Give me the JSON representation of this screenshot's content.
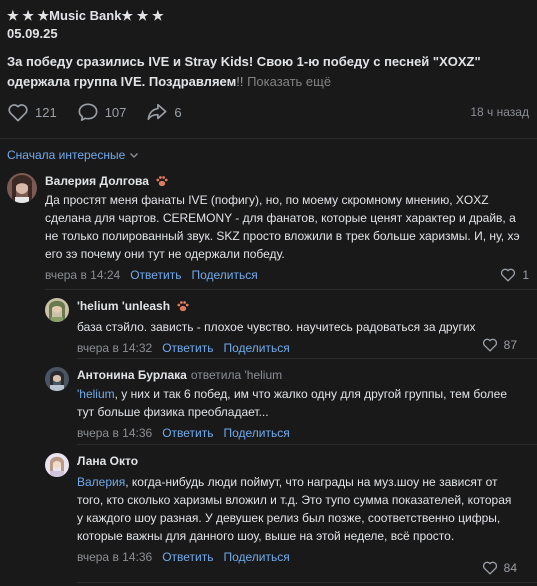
{
  "post": {
    "header": "★ ★ ★Music Bank★ ★ ★",
    "date": "05.09.25",
    "text_main": "За победу сразились IVE и Stray Kids! Свою 1-ю победу с песней \"XOXZ\" одержала группа IVE. Поздравляем",
    "text_fade": "!!",
    "show_more": "Показать ещё",
    "likes": "121",
    "comments": "107",
    "shares": "6",
    "time": "18 ч назад"
  },
  "sort_label": "Сначала интересные",
  "comments": [
    {
      "author": "Валерия Долгова",
      "text": "Да простят меня фанаты IVE (пофигу), но, по моему скромному мнению, XOXZ сделана для чартов. CEREMONY - для фанатов, которые ценят характер и драйв, а не только полированный звук. SKZ просто вложили в трек больше харизмы. И, ну, хэ его зэ почему они тут не одержали победу.",
      "time": "вчера в 14:24",
      "reply": "Ответить",
      "share": "Поделиться",
      "likes": "1"
    },
    {
      "author": "'helium 'unleash",
      "text": "база стэйло. зависть - плохое чувство. научитесь радоваться за других",
      "time": "вчера в 14:32",
      "reply": "Ответить",
      "share": "Поделиться",
      "likes": "87"
    },
    {
      "author": "Антонина Бурлака",
      "reply_to": "ответила 'helium",
      "addressee": "'helium",
      "text": ", у них и так 6 побед, им что жалко одну для другой группы, тем более тут больше физика преобладает...",
      "time": "вчера в 14:36",
      "reply": "Ответить",
      "share": "Поделиться"
    },
    {
      "author": "Лана Окто",
      "addressee": "Валерия",
      "text": ", когда-нибудь люди поймут, что награды на муз.шоу не зависят от того, кто сколько харизмы вложил и т.д. Это тупо сумма показателей, которая у каждого шоу разная. У девушек релиз был позже, соответственно цифры, которые важны для данного шоу, выше на этой неделе, всё просто.",
      "time": "вчера в 14:36",
      "reply": "Ответить",
      "share": "Поделиться",
      "likes": "84"
    }
  ],
  "colors": {
    "background": "#19191a",
    "link": "#71aaeb",
    "text": "#e1e3e6",
    "muted": "#8b8e93"
  }
}
